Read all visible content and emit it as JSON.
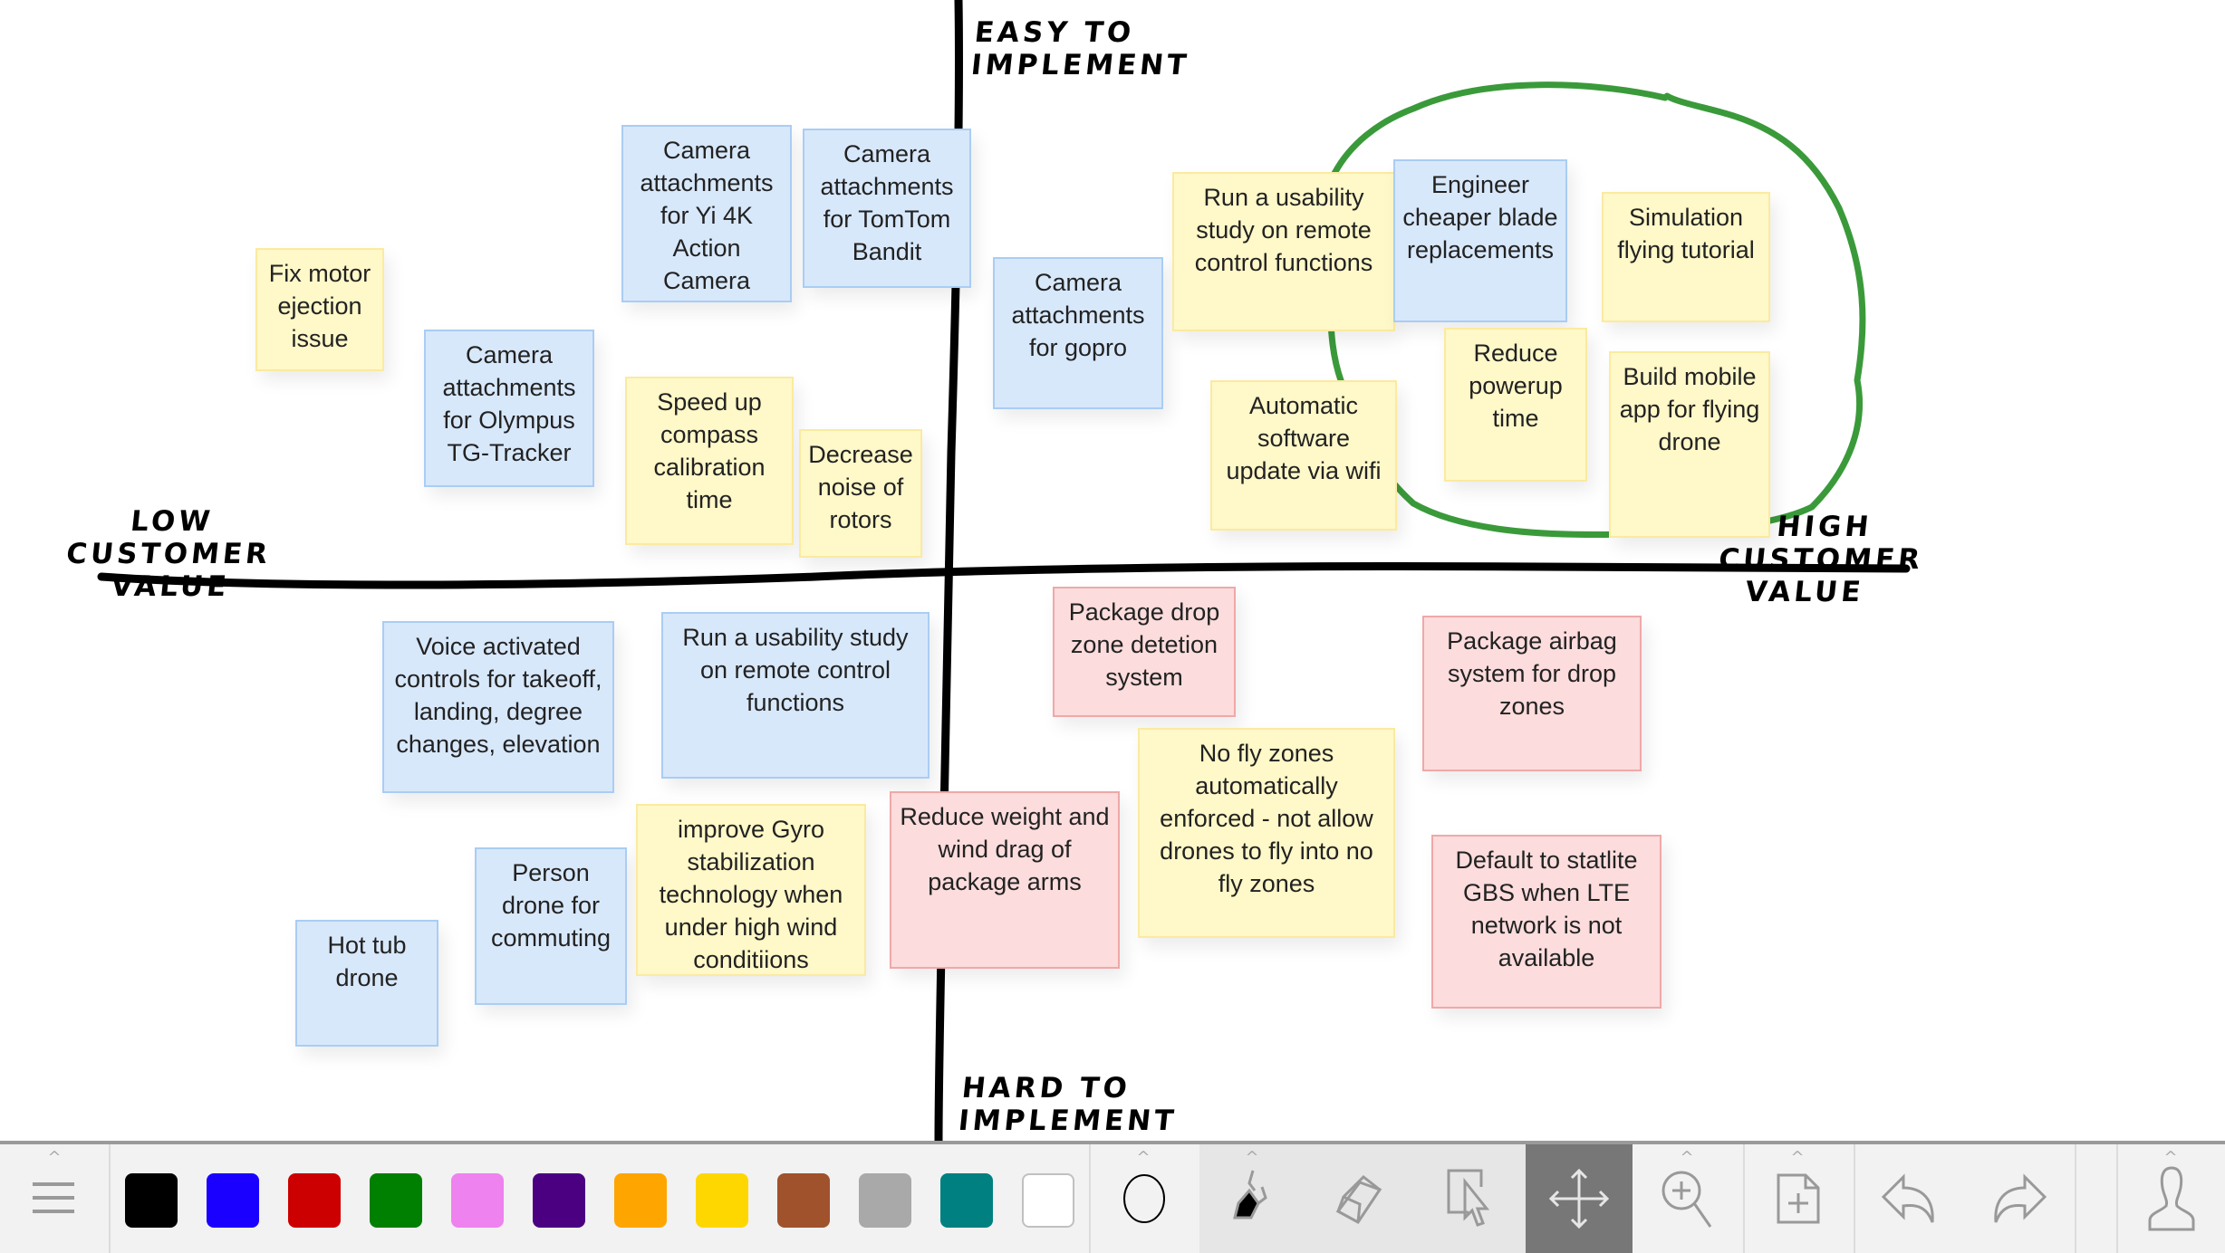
{
  "board": {
    "axis_labels": {
      "top": "EASY TO IMPLEMENT",
      "bottom": "HARD TO IMPLEMENT",
      "left_line1": "LOW CUSTOMER",
      "left_line2": "VALUE",
      "right_line1": "HIGH CUSTOMER",
      "right_line2": "VALUE"
    },
    "highlight_circle_color": "#3a9a3a",
    "notes": [
      {
        "id": "fix-motor",
        "text": "Fix motor ejection issue",
        "color": "yellow"
      },
      {
        "id": "camera-yi",
        "text": "Camera attachments for Yi 4K Action Camera",
        "color": "blue"
      },
      {
        "id": "camera-tomtom",
        "text": "Camera attachments for TomTom Bandit",
        "color": "blue"
      },
      {
        "id": "camera-olympus",
        "text": "Camera attachments for Olympus TG-Tracker",
        "color": "blue"
      },
      {
        "id": "speed-compass",
        "text": "Speed up compass calibration time",
        "color": "yellow"
      },
      {
        "id": "decrease-noise",
        "text": "Decrease noise of rotors",
        "color": "yellow"
      },
      {
        "id": "camera-gopro",
        "text": "Camera attachments for gopro",
        "color": "blue"
      },
      {
        "id": "usability-study-yellow",
        "text": "Run a usability study on remote control functions",
        "color": "yellow"
      },
      {
        "id": "engineer-blades",
        "text": "Engineer cheaper blade replacements",
        "color": "blue"
      },
      {
        "id": "simulation-tutorial",
        "text": "Simulation flying tutorial",
        "color": "yellow"
      },
      {
        "id": "auto-update",
        "text": "Automatic software update via wifi",
        "color": "yellow"
      },
      {
        "id": "reduce-powerup",
        "text": "Reduce powerup time",
        "color": "yellow"
      },
      {
        "id": "mobile-app",
        "text": "Build mobile app for flying drone",
        "color": "yellow"
      },
      {
        "id": "voice-controls",
        "text": "Voice activated controls for takeoff, landing, degree changes, elevation",
        "color": "blue"
      },
      {
        "id": "usability-study-blue",
        "text": "Run a usability study on remote control functions",
        "color": "blue"
      },
      {
        "id": "hot-tub",
        "text": "Hot tub drone",
        "color": "blue"
      },
      {
        "id": "person-drone",
        "text": "Person drone for commuting",
        "color": "blue"
      },
      {
        "id": "gyro",
        "text": "improve Gyro stabilization technology when under high wind conditiions",
        "color": "yellow"
      },
      {
        "id": "reduce-weight",
        "text": "Reduce weight and wind drag of package arms",
        "color": "pink"
      },
      {
        "id": "drop-zone-detection",
        "text": "Package drop zone detetion system",
        "color": "pink"
      },
      {
        "id": "no-fly-zones",
        "text": "No fly zones automatically enforced - not allow drones to fly into no fly zones",
        "color": "yellow"
      },
      {
        "id": "airbag",
        "text": "Package airbag system for drop zones",
        "color": "pink"
      },
      {
        "id": "satellite-gps",
        "text": "Default to statlite GBS when LTE network is not available",
        "color": "pink"
      }
    ]
  },
  "toolbar": {
    "menu_icon": "hamburger-menu-icon",
    "colors": [
      {
        "name": "black",
        "hex": "#000000"
      },
      {
        "name": "blue",
        "hex": "#1a00ff"
      },
      {
        "name": "red",
        "hex": "#cc0000"
      },
      {
        "name": "green",
        "hex": "#008000"
      },
      {
        "name": "pink",
        "hex": "#ee82ee"
      },
      {
        "name": "purple",
        "hex": "#4b0082"
      },
      {
        "name": "orange",
        "hex": "#ffa500"
      },
      {
        "name": "yellow",
        "hex": "#ffd700"
      },
      {
        "name": "brown",
        "hex": "#a0522d"
      },
      {
        "name": "gray",
        "hex": "#a9a9a9"
      },
      {
        "name": "teal",
        "hex": "#008080"
      },
      {
        "name": "white",
        "hex": "#ffffff"
      }
    ],
    "tools": [
      "stroke-size",
      "marker",
      "eraser",
      "select",
      "pan",
      "zoom-in",
      "add-page",
      "undo",
      "redo",
      "account"
    ],
    "active_tool": "pan",
    "expand_caret": "^"
  }
}
